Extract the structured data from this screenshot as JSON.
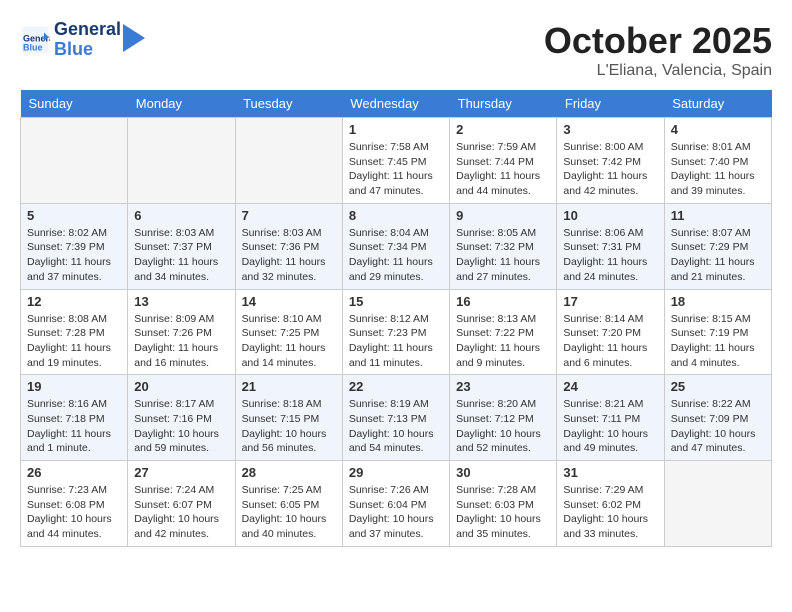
{
  "header": {
    "logo_line1": "General",
    "logo_line2": "Blue",
    "month": "October 2025",
    "location": "L'Eliana, Valencia, Spain"
  },
  "weekdays": [
    "Sunday",
    "Monday",
    "Tuesday",
    "Wednesday",
    "Thursday",
    "Friday",
    "Saturday"
  ],
  "weeks": [
    [
      {
        "day": "",
        "info": ""
      },
      {
        "day": "",
        "info": ""
      },
      {
        "day": "",
        "info": ""
      },
      {
        "day": "1",
        "info": "Sunrise: 7:58 AM\nSunset: 7:45 PM\nDaylight: 11 hours and 47 minutes."
      },
      {
        "day": "2",
        "info": "Sunrise: 7:59 AM\nSunset: 7:44 PM\nDaylight: 11 hours and 44 minutes."
      },
      {
        "day": "3",
        "info": "Sunrise: 8:00 AM\nSunset: 7:42 PM\nDaylight: 11 hours and 42 minutes."
      },
      {
        "day": "4",
        "info": "Sunrise: 8:01 AM\nSunset: 7:40 PM\nDaylight: 11 hours and 39 minutes."
      }
    ],
    [
      {
        "day": "5",
        "info": "Sunrise: 8:02 AM\nSunset: 7:39 PM\nDaylight: 11 hours and 37 minutes."
      },
      {
        "day": "6",
        "info": "Sunrise: 8:03 AM\nSunset: 7:37 PM\nDaylight: 11 hours and 34 minutes."
      },
      {
        "day": "7",
        "info": "Sunrise: 8:03 AM\nSunset: 7:36 PM\nDaylight: 11 hours and 32 minutes."
      },
      {
        "day": "8",
        "info": "Sunrise: 8:04 AM\nSunset: 7:34 PM\nDaylight: 11 hours and 29 minutes."
      },
      {
        "day": "9",
        "info": "Sunrise: 8:05 AM\nSunset: 7:32 PM\nDaylight: 11 hours and 27 minutes."
      },
      {
        "day": "10",
        "info": "Sunrise: 8:06 AM\nSunset: 7:31 PM\nDaylight: 11 hours and 24 minutes."
      },
      {
        "day": "11",
        "info": "Sunrise: 8:07 AM\nSunset: 7:29 PM\nDaylight: 11 hours and 21 minutes."
      }
    ],
    [
      {
        "day": "12",
        "info": "Sunrise: 8:08 AM\nSunset: 7:28 PM\nDaylight: 11 hours and 19 minutes."
      },
      {
        "day": "13",
        "info": "Sunrise: 8:09 AM\nSunset: 7:26 PM\nDaylight: 11 hours and 16 minutes."
      },
      {
        "day": "14",
        "info": "Sunrise: 8:10 AM\nSunset: 7:25 PM\nDaylight: 11 hours and 14 minutes."
      },
      {
        "day": "15",
        "info": "Sunrise: 8:12 AM\nSunset: 7:23 PM\nDaylight: 11 hours and 11 minutes."
      },
      {
        "day": "16",
        "info": "Sunrise: 8:13 AM\nSunset: 7:22 PM\nDaylight: 11 hours and 9 minutes."
      },
      {
        "day": "17",
        "info": "Sunrise: 8:14 AM\nSunset: 7:20 PM\nDaylight: 11 hours and 6 minutes."
      },
      {
        "day": "18",
        "info": "Sunrise: 8:15 AM\nSunset: 7:19 PM\nDaylight: 11 hours and 4 minutes."
      }
    ],
    [
      {
        "day": "19",
        "info": "Sunrise: 8:16 AM\nSunset: 7:18 PM\nDaylight: 11 hours and 1 minute."
      },
      {
        "day": "20",
        "info": "Sunrise: 8:17 AM\nSunset: 7:16 PM\nDaylight: 10 hours and 59 minutes."
      },
      {
        "day": "21",
        "info": "Sunrise: 8:18 AM\nSunset: 7:15 PM\nDaylight: 10 hours and 56 minutes."
      },
      {
        "day": "22",
        "info": "Sunrise: 8:19 AM\nSunset: 7:13 PM\nDaylight: 10 hours and 54 minutes."
      },
      {
        "day": "23",
        "info": "Sunrise: 8:20 AM\nSunset: 7:12 PM\nDaylight: 10 hours and 52 minutes."
      },
      {
        "day": "24",
        "info": "Sunrise: 8:21 AM\nSunset: 7:11 PM\nDaylight: 10 hours and 49 minutes."
      },
      {
        "day": "25",
        "info": "Sunrise: 8:22 AM\nSunset: 7:09 PM\nDaylight: 10 hours and 47 minutes."
      }
    ],
    [
      {
        "day": "26",
        "info": "Sunrise: 7:23 AM\nSunset: 6:08 PM\nDaylight: 10 hours and 44 minutes."
      },
      {
        "day": "27",
        "info": "Sunrise: 7:24 AM\nSunset: 6:07 PM\nDaylight: 10 hours and 42 minutes."
      },
      {
        "day": "28",
        "info": "Sunrise: 7:25 AM\nSunset: 6:05 PM\nDaylight: 10 hours and 40 minutes."
      },
      {
        "day": "29",
        "info": "Sunrise: 7:26 AM\nSunset: 6:04 PM\nDaylight: 10 hours and 37 minutes."
      },
      {
        "day": "30",
        "info": "Sunrise: 7:28 AM\nSunset: 6:03 PM\nDaylight: 10 hours and 35 minutes."
      },
      {
        "day": "31",
        "info": "Sunrise: 7:29 AM\nSunset: 6:02 PM\nDaylight: 10 hours and 33 minutes."
      },
      {
        "day": "",
        "info": ""
      }
    ]
  ]
}
